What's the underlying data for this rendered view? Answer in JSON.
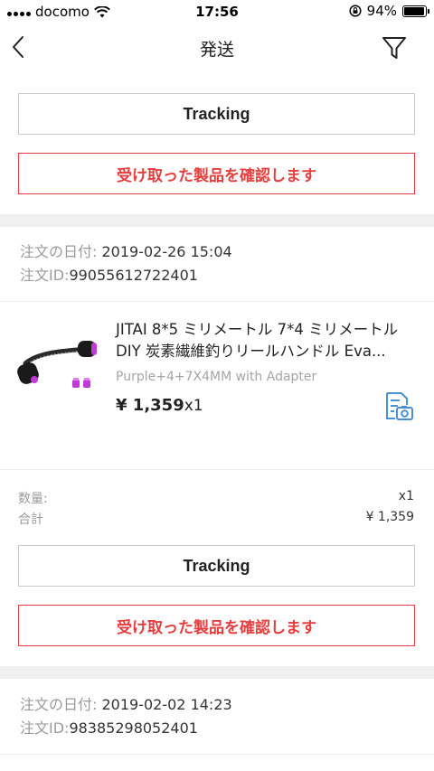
{
  "status_bar": {
    "carrier": "docomo",
    "time": "17:56",
    "battery": "94%",
    "battery_level": 0.94
  },
  "nav": {
    "title": "発送",
    "back_icon": "chevron-left-icon",
    "filter_icon": "filter-icon"
  },
  "orders": [
    {
      "tracking_label": "Tracking",
      "confirm_label": "受け取った製品を確認します"
    },
    {
      "date_label": "注文の日付:",
      "date_value": " 2019-02-26 15:04",
      "id_label": "注文ID:",
      "id_value": "99055612722401",
      "product": {
        "title": "JITAI 8*5 ミリメートル 7*4 ミリメートル DIY 炭素繊維釣りリールハンドル Eva...",
        "variant": "Purple+4+7X4MM with Adapter",
        "price": "¥ 1,359",
        "qty_suffix": "x1"
      },
      "summary": {
        "qty_label": "数量:",
        "qty_value": "x1",
        "total_label": "合計",
        "total_value": "¥ 1,359"
      },
      "tracking_label": "Tracking",
      "confirm_label": "受け取った製品を確認します"
    },
    {
      "date_label": "注文の日付:",
      "date_value": " 2019-02-02 14:23",
      "id_label": "注文ID:",
      "id_value": "98385298052401"
    }
  ],
  "colors": {
    "accent_red": "#e63e3e",
    "link_blue": "#4a90d9",
    "product_purple": "#c03ad6"
  }
}
